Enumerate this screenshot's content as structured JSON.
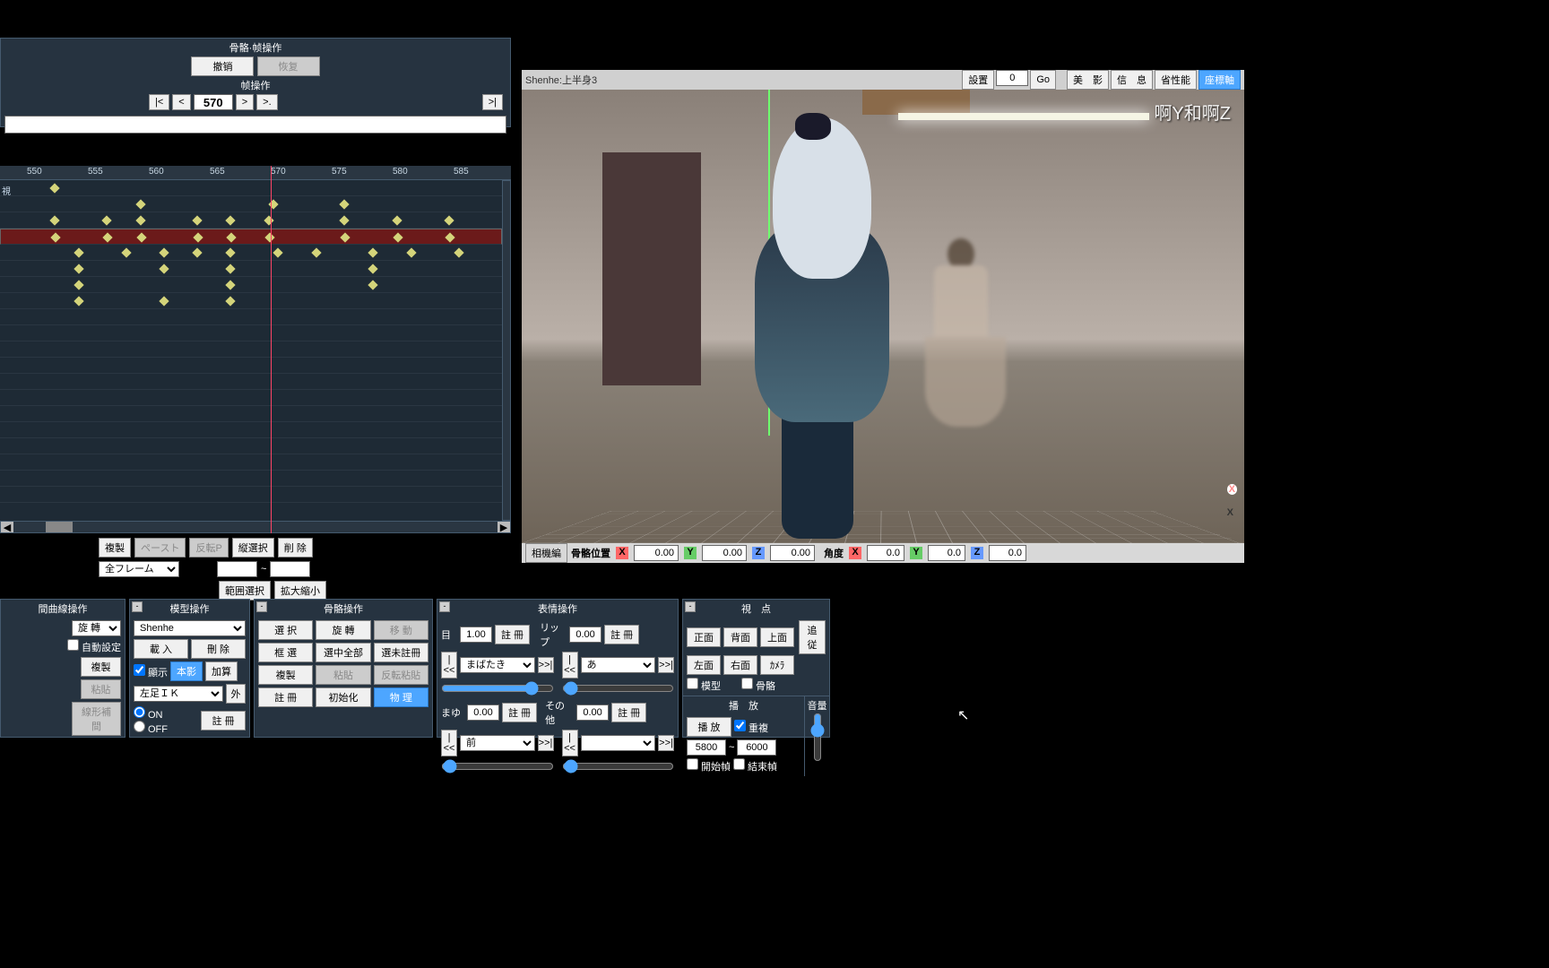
{
  "timeline": {
    "header1": "骨骼·帧操作",
    "undo": "撤销",
    "redo": "恢复",
    "header2": "帧操作",
    "nav_first": "|<",
    "nav_prev": "<",
    "current_frame": "570",
    "nav_next": ">",
    "nav_step": ">.",
    "nav_last": ">|",
    "ticks": [
      "550",
      "555",
      "560",
      "565",
      "570",
      "575",
      "580",
      "585"
    ],
    "row_label": "視",
    "sel_row_idx": 3,
    "playhead_pct": 53,
    "keyframes": [
      [
        7
      ],
      [
        25,
        53,
        68
      ],
      [
        7,
        18,
        25,
        37,
        44,
        52,
        68,
        79,
        90
      ],
      [
        7,
        18,
        25,
        37,
        44,
        52,
        68,
        79,
        90
      ],
      [
        12,
        22,
        30,
        37,
        44,
        54,
        62,
        74,
        82,
        92
      ],
      [
        12,
        30,
        44,
        74
      ],
      [
        12,
        44,
        74
      ],
      [
        12,
        30,
        44
      ],
      []
    ],
    "btns_copy": "複製",
    "btns_paste": "ペースト",
    "btns_flip": "反転P",
    "btns_colsel": "縦選択",
    "btns_del": "削 除",
    "frame_scope": "全フレーム",
    "range_sep": "~",
    "btns_rangesel": "範囲選択",
    "btns_zoom": "拡大縮小"
  },
  "viewport": {
    "title": "Shenhe:上半身3",
    "btn_set": "設置",
    "set_val": "0",
    "btn_go": "Go",
    "btn_bi": "美　影",
    "btn_info": "信　息",
    "btn_perf": "省性能",
    "btn_local": "座標軸",
    "watermark": "啊Y和啊Z",
    "stat_mode": "相機編",
    "stat_pos": "骨骼位置",
    "pos_x": "0.00",
    "pos_y": "0.00",
    "pos_z": "0.00",
    "stat_ang": "角度",
    "ang_x": "0.0",
    "ang_y": "0.0",
    "ang_z": "0.0"
  },
  "p1": {
    "title": "間曲線操作",
    "rot": "旋 轉",
    "auto": "自動設定",
    "copy": "複製",
    "paste": "粘貼",
    "interp": "線形補間"
  },
  "p2": {
    "title": "模型操作",
    "model": "Shenhe",
    "load": "載 入",
    "del": "刪 除",
    "show": "顯示",
    "body": "本影",
    "add": "加算",
    "bone_sel": "左足ＩＫ",
    "ext": "外",
    "on": "ON",
    "off": "OFF",
    "reg": "註 冊"
  },
  "p3": {
    "title": "骨骼操作",
    "select": "選 択",
    "rotate": "旋 轉",
    "move": "移 動",
    "boxsel": "框 選",
    "selall": "選中全部",
    "selunreg": "選未註冊",
    "copy": "複製",
    "paste": "粘貼",
    "flippaste": "反転粘貼",
    "regdel": "註 冊",
    "init": "初始化",
    "physics": "物 理"
  },
  "p4": {
    "title": "表情操作",
    "eye": "目",
    "eye_val": "1.00",
    "reg": "註 冊",
    "lip": "リップ",
    "lip_val": "0.00",
    "blink_sel": "まばたき",
    "a_sel": "あ",
    "brow": "まゆ",
    "brow_val": "0.00",
    "other": "その他",
    "other_val": "0.00",
    "prev_sel": "前",
    "nav_ll": "|<<",
    "nav_l": "<",
    "nav_r": ">",
    "nav_rr": ">>|"
  },
  "p5": {
    "title": "視　点",
    "front": "正面",
    "back": "背面",
    "top": "上面",
    "left": "左面",
    "right": "右面",
    "cam": "ｶﾒﾗ",
    "follow": "追従",
    "model": "模型",
    "bone": "骨骼",
    "play_title": "播　放",
    "play": "播 放",
    "repeat": "重複",
    "from": "5800",
    "to": "6000",
    "startf": "開始幀",
    "endf": "結束幀",
    "vol": "音量"
  }
}
